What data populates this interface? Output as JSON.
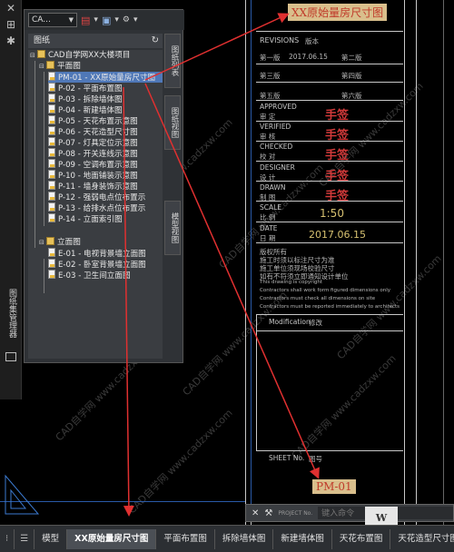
{
  "palette": {
    "combo": "CA...",
    "header": "图纸",
    "tabs": {
      "sheet_list": "图纸列表",
      "sheet_views": "图纸视图",
      "model_views": "模型视图"
    },
    "tree": {
      "root": "CAD自学网XX大楼项目",
      "group1": "平面图",
      "sheets1": [
        "PM-01 - XX原始量房尺寸图",
        "P-02 - 平面布置图",
        "P-03 - 拆除墙体图",
        "P-04 - 新建墙体图",
        "P-05 - 天花布置示意图",
        "P-06 - 天花造型尺寸图",
        "P-07 - 灯具定位示意图",
        "P-08 - 开关连线示意图",
        "P-09 - 空调布置示意图",
        "P-10 - 地面铺装示意图",
        "P-11 - 墙身装饰示意图",
        "P-12 - 强弱电点位布置示",
        "P-13 - 给排水点位布置示",
        "P-14 - 立面索引图"
      ],
      "group2": "立面图",
      "sheets2": [
        "E-01 - 电视背景墙立面图",
        "E-02 - 卧室背景墙立面图",
        "E-03 - 卫生间立面图"
      ]
    }
  },
  "left_strip": {
    "label": "图纸集管理器"
  },
  "titleblock": {
    "top_label": "XX原始量房尺寸图",
    "revisions": "REVISIONS",
    "revisions_cn": "版本",
    "rev1": "第一版",
    "rev1_date": "2017.06.15",
    "rev2": "第二版",
    "rev3": "第三版",
    "rev4": "第四版",
    "rev5": "第五版",
    "rev6": "第六版",
    "approved_en": "APPROVED",
    "approved_cn": "审 定",
    "verified_en": "VERIFIED",
    "verified_cn": "审 核",
    "checked_en": "CHECKED",
    "checked_cn": "校 对",
    "designer_en": "DESIGNER",
    "designer_cn": "设 计",
    "drawn_en": "DRAWN",
    "drawn_cn": "制 图",
    "signature": "手签",
    "scale_en": "SCALE",
    "scale_cn": "比 例",
    "scale_val": "1:50",
    "date_en": "DATE",
    "date_cn": "日 期",
    "date_val": "2017.06.15",
    "notes": [
      "版权所有",
      "施工时须以标注尺寸为准",
      "施工单位须现场校验尺寸",
      "如有不符须立即通知设计单位",
      "This drawing is copyright",
      "Contractors shall work form figured dimensions only",
      "Contractors must check all dimensions on site",
      "Contractors must be reported immediately to architects"
    ],
    "modification_en": "Modification",
    "modification_cn": "修改",
    "sheetno_en": "SHEET No.",
    "sheetno_cn": "图号",
    "sheetno_val": "PM-01"
  },
  "watermark": "CAD自学网 www.cadzxw.com",
  "cmdline": {
    "close": "✕",
    "placeholder": "键入命令",
    "prompt": "PROJECT No."
  },
  "layout_tabs": [
    "模型",
    "XX原始量房尺寸图",
    "平面布置图",
    "拆除墙体图",
    "新建墙体图",
    "天花布置图",
    "天花造型尺寸图"
  ],
  "active_tab": "XX原始量房尺寸图",
  "logo": "W"
}
